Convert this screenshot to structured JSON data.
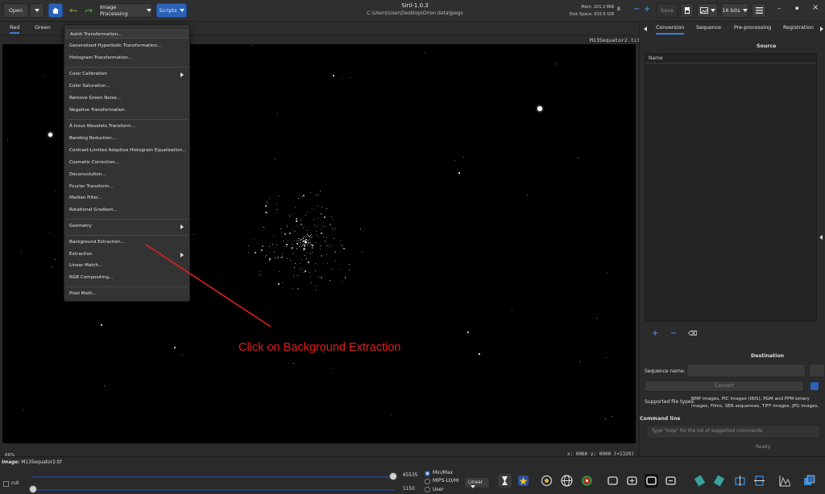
{
  "header": {
    "open_label": "Open",
    "image_processing_label": "Image Processing",
    "scripts_label": "Scripts",
    "title": "Siril-1.0.3",
    "path": "C:\\Users\\User\\Desktop\\Orion data\\Jpegs",
    "mem": "Mem: 201.2 MiB",
    "disk": "Disk Space: 633.6 GiB",
    "thread_count": "8",
    "save_label": "Save",
    "bits_label": "16 bits",
    "minimize_icon": "–",
    "maximize_icon": "▪",
    "close_icon": "×"
  },
  "channel_tabs": [
    "Red",
    "Green"
  ],
  "image_filename": "M13Sequator2.tif",
  "menu": {
    "items": [
      "Asinh Transformation...",
      "Generalised Hyperbolic Transformation...",
      "Histogram Transformation...",
      "Color Calibration",
      "Color Saturation...",
      "Remove Green Noise...",
      "Negative Transformation",
      "À trous Wavelets Transform...",
      "Banding Reduction...",
      "Contrast-Limited Adaptive Histogram Equalization...",
      "Cosmetic Correction...",
      "Deconvolution...",
      "Fourier Transform...",
      "Median Filter...",
      "Rotational Gradient...",
      "Geometry",
      "Background Extraction...",
      "Extraction",
      "Linear Match...",
      "RGB Compositing...",
      "Pixel Math..."
    ]
  },
  "annotation": "Click on Background Extraction",
  "status": {
    "zoom": "66%",
    "coords": "x: 0060 y: 0000 (=1320)"
  },
  "right_panel": {
    "tabs": [
      "Conversion",
      "Sequence",
      "Pre-processing",
      "Registration"
    ],
    "source_title": "Source",
    "list_header": "Name",
    "add_icon": "+",
    "remove_icon": "−",
    "clear_icon": "⌫",
    "destination_title": "Destination",
    "sequence_name_label": "Sequence name:",
    "convert_label": "Convert",
    "supported_label": "Supported file types:",
    "supported_text": "BMP images, PIC images (IRIS), PGM and PPM binary images, Films, SER sequences, TIFF images, JPG images,",
    "command_line_label": "Command line",
    "command_placeholder": "Type \"help\" for the list of supported commands",
    "ready": "Ready."
  },
  "bottom": {
    "image_label": "Image:",
    "image_name": "M13Sequator2.tif",
    "max_value": "65535",
    "min_value": "1150",
    "cut_label": "cut",
    "modes": [
      "Min/Max",
      "MIPS-LO/HI",
      "User"
    ],
    "selected_mode": "Min/Max",
    "scale_label": "Linear"
  },
  "colors": {
    "accent": "#2b62b8",
    "annotation": "#e01e1e"
  }
}
